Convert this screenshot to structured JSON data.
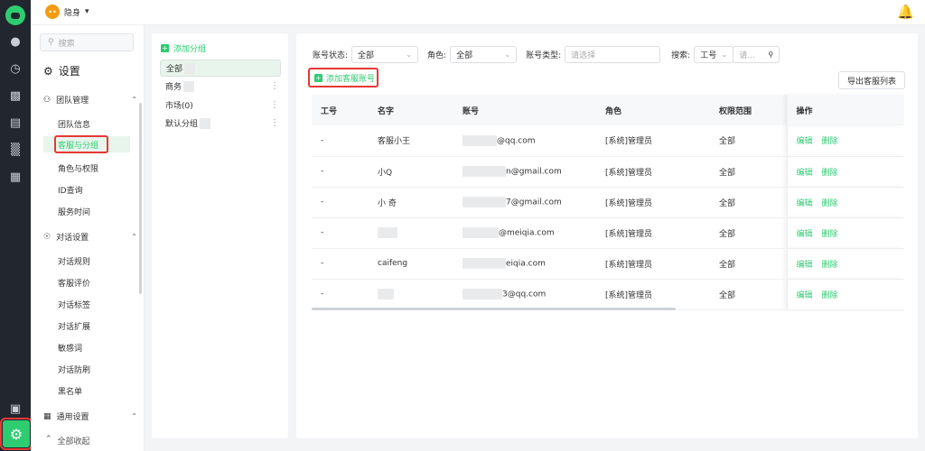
{
  "topbar": {
    "brand": "隐身",
    "brand_icon": "chat-bubble-icon"
  },
  "menu": {
    "search_placeholder": "搜索",
    "title": "设置",
    "sections": [
      {
        "label": "团队管理",
        "items": [
          "团队信息",
          "客服与分组",
          "角色与权限",
          "ID查询",
          "服务时间"
        ]
      },
      {
        "label": "对话设置",
        "items": [
          "对话规则",
          "客服评价",
          "对话标签",
          "对话扩展",
          "敏感词",
          "对话防刷",
          "黑名单"
        ]
      },
      {
        "label": "通用设置",
        "items": []
      }
    ],
    "collapse_label": "全部收起"
  },
  "groups": {
    "add_label": "添加分组",
    "items": [
      {
        "name": "全部"
      },
      {
        "name": "商务"
      },
      {
        "name": "市场(0)"
      },
      {
        "name": "默认分组"
      }
    ]
  },
  "filters": {
    "status_label": "账号状态:",
    "status_value": "全部",
    "role_label": "角色:",
    "role_value": "全部",
    "type_label": "账号类型:",
    "type_placeholder": "请选择",
    "search_label": "搜索:",
    "search_field": "工号",
    "search_placeholder": "请..."
  },
  "actions": {
    "add_account": "添加客服账号",
    "export": "导出客服列表"
  },
  "table": {
    "headers": [
      "工号",
      "名字",
      "账号",
      "角色",
      "权限范围",
      "操作"
    ],
    "rows": [
      {
        "id": "-",
        "name": "客服小王",
        "account": "@qq.com",
        "role": "[系统]管理员",
        "scope": "全部"
      },
      {
        "id": "-",
        "name": "小Q",
        "account": "n@gmail.com",
        "role": "[系统]管理员",
        "scope": "全部"
      },
      {
        "id": "-",
        "name": "小 奇",
        "account": "7@gmail.com",
        "role": "[系统]管理员",
        "scope": "全部"
      },
      {
        "id": "-",
        "name": "",
        "account": "@meiqia.com",
        "role": "[系统]管理员",
        "scope": "全部"
      },
      {
        "id": "-",
        "name": "caifeng",
        "account": "eiqia.com",
        "role": "[系统]管理员",
        "scope": "全部"
      },
      {
        "id": "-",
        "name": "",
        "account": "3@qq.com",
        "role": "[系统]管理员",
        "scope": "全部"
      }
    ],
    "edit_label": "编辑",
    "delete_label": "删除"
  },
  "colors": {
    "accent": "#2ecc71",
    "highlight": "#e53935",
    "rail": "#21262f"
  }
}
